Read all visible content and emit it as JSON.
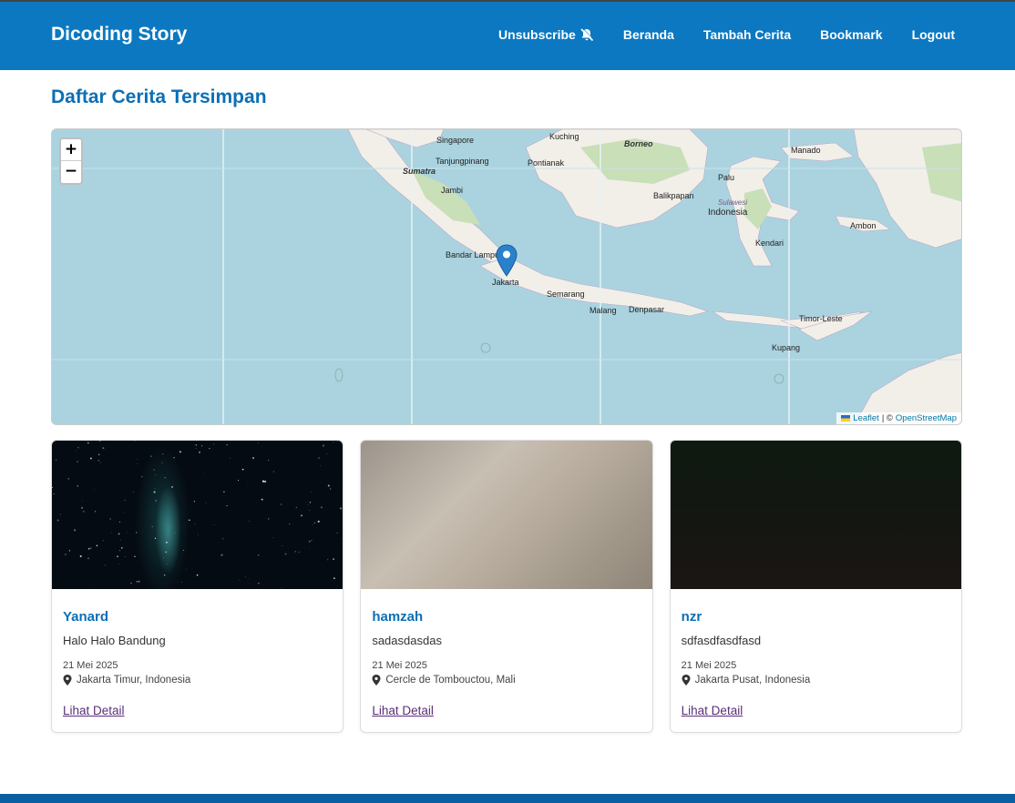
{
  "header": {
    "brand": "Dicoding Story",
    "nav": [
      {
        "label": "Unsubscribe",
        "icon": "bell-slash-icon"
      },
      {
        "label": "Beranda"
      },
      {
        "label": "Tambah Cerita"
      },
      {
        "label": "Bookmark"
      },
      {
        "label": "Logout"
      }
    ]
  },
  "page": {
    "title": "Daftar Cerita Tersimpan"
  },
  "map": {
    "zoom_in": "+",
    "zoom_out": "−",
    "attribution": {
      "leaflet": "Leaflet",
      "separator": "| ©",
      "osm": "OpenStreetMap"
    },
    "labels": [
      "Singapore",
      "Kuching",
      "Borneo",
      "Manado",
      "Sumatra",
      "Tanjungpinang",
      "Pontianak",
      "Palu",
      "Jambi",
      "Balikpapan",
      "Sulawesi",
      "Indonesia",
      "Ambon",
      "Bandar Lampung",
      "Kendari",
      "Jakarta",
      "Semarang",
      "Malang",
      "Denpasar",
      "Timor-Leste",
      "Kupang"
    ],
    "marker_icon": "map-pin-icon"
  },
  "stories": [
    {
      "name": "Yanard",
      "description": "Halo Halo Bandung",
      "date": "21 Mei 2025",
      "location": "Jakarta Timur, Indonesia",
      "link": "Lihat Detail"
    },
    {
      "name": "hamzah",
      "description": "sadasdasdas",
      "date": "21 Mei 2025",
      "location": "Cercle de Tombouctou, Mali",
      "link": "Lihat Detail"
    },
    {
      "name": "nzr",
      "description": "sdfasdfasdfasd",
      "date": "21 Mei 2025",
      "location": "Jakarta Pusat, Indonesia",
      "link": "Lihat Detail"
    }
  ]
}
